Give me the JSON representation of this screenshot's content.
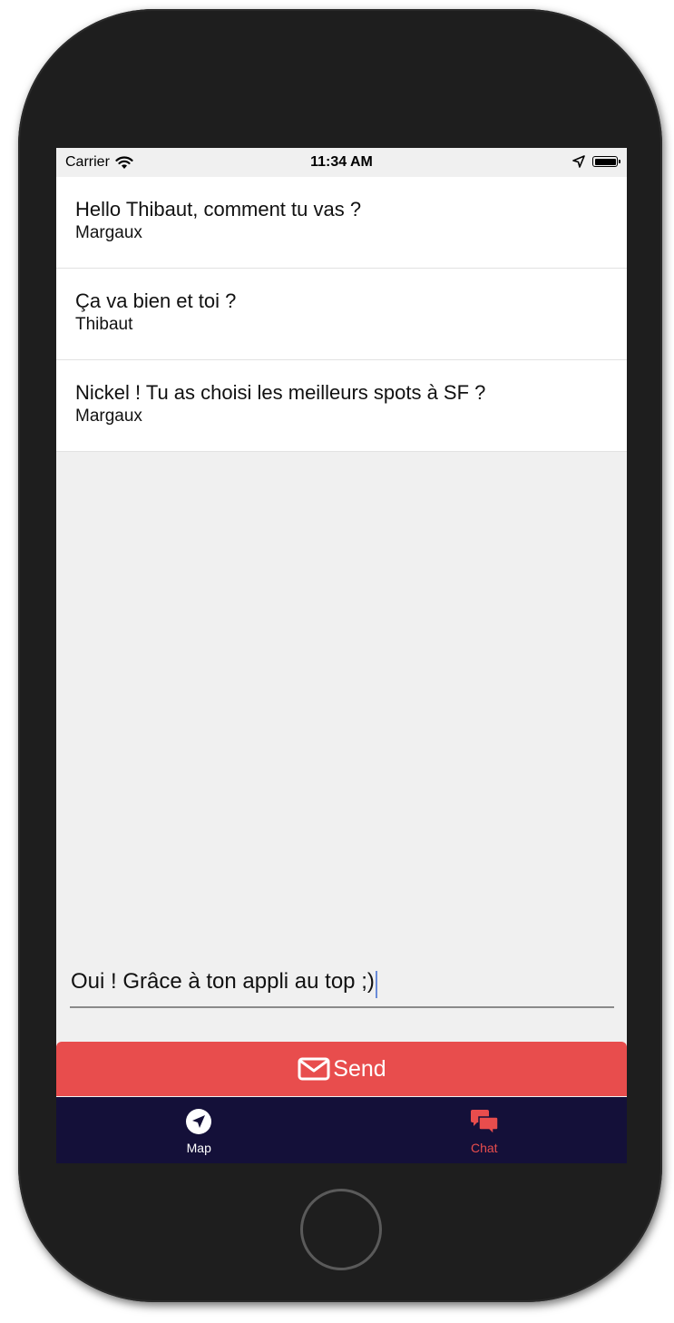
{
  "status_bar": {
    "carrier": "Carrier",
    "time": "11:34 AM",
    "icons": [
      "wifi-icon",
      "location-icon",
      "battery-icon"
    ]
  },
  "messages": [
    {
      "text": "Hello Thibaut, comment tu vas ?",
      "author": "Margaux"
    },
    {
      "text": "Ça va bien et toi ?",
      "author": "Thibaut"
    },
    {
      "text": "Nickel ! Tu as choisi les meilleurs spots à SF ?",
      "author": "Margaux"
    }
  ],
  "composer": {
    "value": "Oui ! Grâce à ton appli au top ;)"
  },
  "send_button": {
    "label": "Send",
    "icon": "envelope-icon",
    "color": "#e84d4d"
  },
  "tab_bar": {
    "background": "#141039",
    "tabs": [
      {
        "label": "Map",
        "icon": "navigation-arrow-icon",
        "active": false
      },
      {
        "label": "Chat",
        "icon": "chat-bubbles-icon",
        "active": true
      }
    ]
  }
}
